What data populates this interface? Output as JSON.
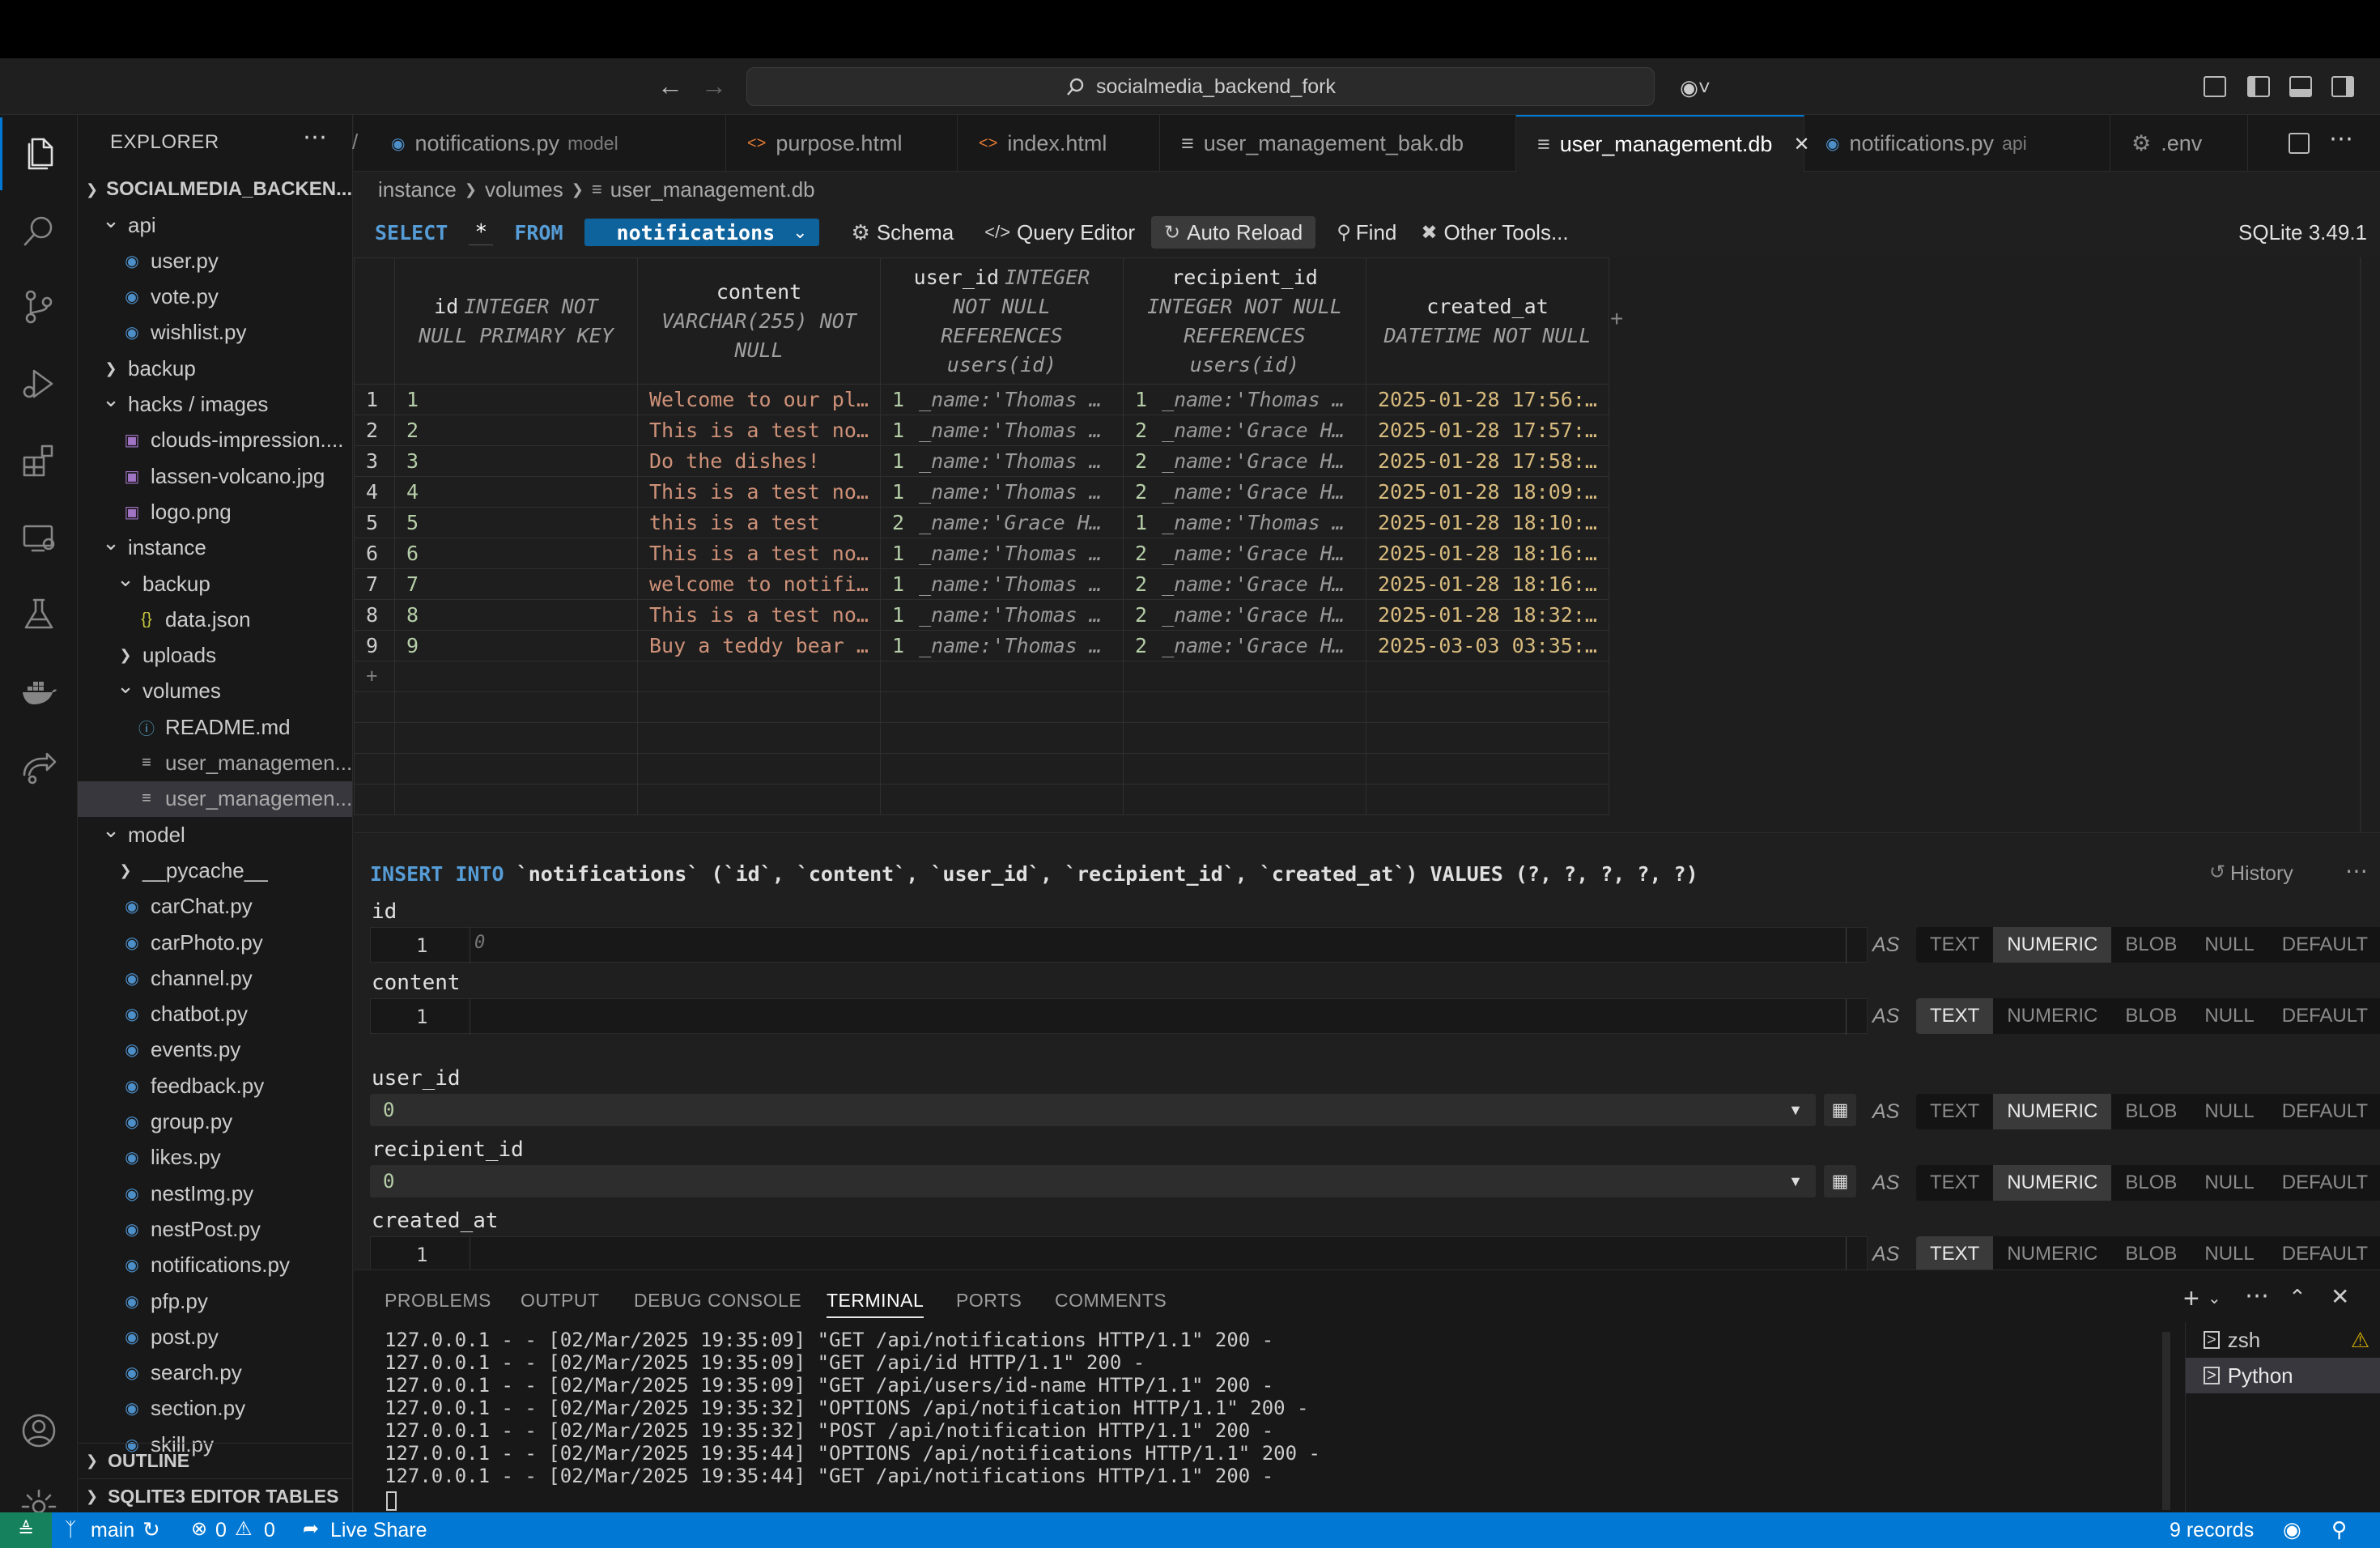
{
  "window": {
    "search": "socialmedia_backend_fork"
  },
  "explorer": {
    "title": "EXPLORER",
    "root": "SOCIALMEDIA_BACKEN...",
    "items": [
      {
        "label": "api",
        "type": "folder-open",
        "indent": 1
      },
      {
        "label": "user.py",
        "type": "py",
        "indent": 2
      },
      {
        "label": "vote.py",
        "type": "py",
        "indent": 2
      },
      {
        "label": "wishlist.py",
        "type": "py",
        "indent": 2
      },
      {
        "label": "backup",
        "type": "folder",
        "indent": 1
      },
      {
        "label": "hacks / images",
        "type": "folder-open",
        "indent": 1
      },
      {
        "label": "clouds-impression....",
        "type": "img",
        "indent": 2
      },
      {
        "label": "lassen-volcano.jpg",
        "type": "img",
        "indent": 2
      },
      {
        "label": "logo.png",
        "type": "img",
        "indent": 2
      },
      {
        "label": "instance",
        "type": "folder-open",
        "indent": 1
      },
      {
        "label": "backup",
        "type": "folder-open",
        "indent": 2
      },
      {
        "label": "data.json",
        "type": "json",
        "indent": 3
      },
      {
        "label": "uploads",
        "type": "folder",
        "indent": 2
      },
      {
        "label": "volumes",
        "type": "folder-open",
        "indent": 2
      },
      {
        "label": "README.md",
        "type": "info",
        "indent": 3
      },
      {
        "label": "user_managemen...",
        "type": "db",
        "indent": 3
      },
      {
        "label": "user_managemen...",
        "type": "db-selected",
        "indent": 3
      },
      {
        "label": "model",
        "type": "folder-open",
        "indent": 1
      },
      {
        "label": "__pycache__",
        "type": "folder",
        "indent": 2
      },
      {
        "label": "carChat.py",
        "type": "py",
        "indent": 2
      },
      {
        "label": "carPhoto.py",
        "type": "py",
        "indent": 2
      },
      {
        "label": "channel.py",
        "type": "py",
        "indent": 2
      },
      {
        "label": "chatbot.py",
        "type": "py",
        "indent": 2
      },
      {
        "label": "events.py",
        "type": "py",
        "indent": 2
      },
      {
        "label": "feedback.py",
        "type": "py",
        "indent": 2
      },
      {
        "label": "group.py",
        "type": "py",
        "indent": 2
      },
      {
        "label": "likes.py",
        "type": "py",
        "indent": 2
      },
      {
        "label": "nestImg.py",
        "type": "py",
        "indent": 2
      },
      {
        "label": "nestPost.py",
        "type": "py",
        "indent": 2
      },
      {
        "label": "notifications.py",
        "type": "py",
        "indent": 2
      },
      {
        "label": "pfp.py",
        "type": "py",
        "indent": 2
      },
      {
        "label": "post.py",
        "type": "py",
        "indent": 2
      },
      {
        "label": "search.py",
        "type": "py",
        "indent": 2
      },
      {
        "label": "section.py",
        "type": "py",
        "indent": 2
      },
      {
        "label": "skill.py",
        "type": "py",
        "indent": 2
      }
    ],
    "outline": "OUTLINE",
    "sqlite_tables": "SQLITE3 EDITOR TABLES"
  },
  "tabs": [
    {
      "label": "notifications.py",
      "desc": "model",
      "icon": "py"
    },
    {
      "label": "purpose.html",
      "desc": "",
      "icon": "html"
    },
    {
      "label": "index.html",
      "desc": "",
      "icon": "html"
    },
    {
      "label": "user_management_bak.db",
      "desc": "",
      "icon": "db"
    },
    {
      "label": "user_management.db",
      "desc": "",
      "icon": "db",
      "active": true
    },
    {
      "label": "notifications.py",
      "desc": "api",
      "icon": "py"
    },
    {
      "label": ".env",
      "desc": "",
      "icon": "gear"
    }
  ],
  "breadcrumb": {
    "a": "instance",
    "b": "volumes",
    "c": "user_management.db"
  },
  "query": {
    "select": "SELECT",
    "star": "*",
    "from": "FROM",
    "table": "notifications",
    "schema": "Schema",
    "query_editor": "Query Editor",
    "auto_reload": "Auto Reload",
    "find": "Find",
    "other_tools": "Other Tools...",
    "version": "SQLite 3.49.1"
  },
  "columns": [
    {
      "name": "id",
      "type": "INTEGER NOT NULL PRIMARY KEY"
    },
    {
      "name": "content",
      "type": "VARCHAR(255) NOT NULL"
    },
    {
      "name": "user_id",
      "type": "INTEGER NOT NULL REFERENCES users(id)"
    },
    {
      "name": "recipient_id",
      "type": "INTEGER NOT NULL REFERENCES users(id)"
    },
    {
      "name": "created_at",
      "type": "DATETIME NOT NULL"
    }
  ],
  "rows": [
    {
      "n": "1",
      "id": "1",
      "content": "Welcome to our pl…",
      "user_id": "1",
      "user_ref": "_name:'Thomas …",
      "recipient_id": "1",
      "recipient_ref": "_name:'Thomas …",
      "created_at": "2025-01-28 17:56:…"
    },
    {
      "n": "2",
      "id": "2",
      "content": "This is a test no…",
      "user_id": "1",
      "user_ref": "_name:'Thomas …",
      "recipient_id": "2",
      "recipient_ref": "_name:'Grace H…",
      "created_at": "2025-01-28 17:57:…"
    },
    {
      "n": "3",
      "id": "3",
      "content": "Do the dishes!",
      "user_id": "1",
      "user_ref": "_name:'Thomas …",
      "recipient_id": "2",
      "recipient_ref": "_name:'Grace H…",
      "created_at": "2025-01-28 17:58:…"
    },
    {
      "n": "4",
      "id": "4",
      "content": "This is a test no…",
      "user_id": "1",
      "user_ref": "_name:'Thomas …",
      "recipient_id": "2",
      "recipient_ref": "_name:'Grace H…",
      "created_at": "2025-01-28 18:09:…"
    },
    {
      "n": "5",
      "id": "5",
      "content": "this is a test",
      "user_id": "2",
      "user_ref": "_name:'Grace H…",
      "recipient_id": "1",
      "recipient_ref": "_name:'Thomas …",
      "created_at": "2025-01-28 18:10:…"
    },
    {
      "n": "6",
      "id": "6",
      "content": "This is a test no…",
      "user_id": "1",
      "user_ref": "_name:'Thomas …",
      "recipient_id": "2",
      "recipient_ref": "_name:'Grace H…",
      "created_at": "2025-01-28 18:16:…"
    },
    {
      "n": "7",
      "id": "7",
      "content": "welcome to notifi…",
      "user_id": "1",
      "user_ref": "_name:'Thomas …",
      "recipient_id": "2",
      "recipient_ref": "_name:'Grace H…",
      "created_at": "2025-01-28 18:16:…"
    },
    {
      "n": "8",
      "id": "8",
      "content": "This is a test no…",
      "user_id": "1",
      "user_ref": "_name:'Thomas …",
      "recipient_id": "2",
      "recipient_ref": "_name:'Grace H…",
      "created_at": "2025-01-28 18:32:…"
    },
    {
      "n": "9",
      "id": "9",
      "content": "Buy a teddy bear …",
      "user_id": "1",
      "user_ref": "_name:'Thomas …",
      "recipient_id": "2",
      "recipient_ref": "_name:'Grace H…",
      "created_at": "2025-03-03 03:35:…"
    }
  ],
  "insert": {
    "sql_kw": "INSERT INTO",
    "sql_rest": "`notifications` (`id`, `content`, `user_id`, `recipient_id`, `created_at`) VALUES (?, ?, ?, ?, ?)",
    "history": "History",
    "as": "AS",
    "types": [
      "TEXT",
      "NUMERIC",
      "BLOB",
      "NULL",
      "DEFAULT"
    ],
    "fields": [
      {
        "name": "id",
        "kind": "editor",
        "line": "1",
        "placeholder": "0",
        "selected": "NUMERIC"
      },
      {
        "name": "content",
        "kind": "editor",
        "line": "1",
        "placeholder": "",
        "selected": "TEXT"
      },
      {
        "name": "user_id",
        "kind": "select",
        "value": "0",
        "selected": "NUMERIC"
      },
      {
        "name": "recipient_id",
        "kind": "select",
        "value": "0",
        "selected": "NUMERIC"
      },
      {
        "name": "created_at",
        "kind": "editor",
        "line": "1",
        "placeholder": "",
        "selected": "TEXT"
      }
    ]
  },
  "panel": {
    "tabs": [
      "PROBLEMS",
      "OUTPUT",
      "DEBUG CONSOLE",
      "TERMINAL",
      "PORTS",
      "COMMENTS"
    ],
    "active": "TERMINAL",
    "terminal_lines": [
      "127.0.0.1 - - [02/Mar/2025 19:35:09] \"GET /api/notifications HTTP/1.1\" 200 -",
      "127.0.0.1 - - [02/Mar/2025 19:35:09] \"GET /api/id HTTP/1.1\" 200 -",
      "127.0.0.1 - - [02/Mar/2025 19:35:09] \"GET /api/users/id-name HTTP/1.1\" 200 -",
      "127.0.0.1 - - [02/Mar/2025 19:35:32] \"OPTIONS /api/notification HTTP/1.1\" 200 -",
      "127.0.0.1 - - [02/Mar/2025 19:35:32] \"POST /api/notification HTTP/1.1\" 200 -",
      "127.0.0.1 - - [02/Mar/2025 19:35:44] \"OPTIONS /api/notifications HTTP/1.1\" 200 -",
      "127.0.0.1 - - [02/Mar/2025 19:35:44] \"GET /api/notifications HTTP/1.1\" 200 -"
    ],
    "shells": [
      "zsh",
      "Python"
    ]
  },
  "status": {
    "branch": "main",
    "errors": "0",
    "warnings": "0",
    "live_share": "Live Share",
    "records": "9 records"
  },
  "colors": {
    "accent": "#0078d4",
    "keyword": "#569cd6",
    "string": "#ce9178",
    "number": "#b5cea8"
  }
}
